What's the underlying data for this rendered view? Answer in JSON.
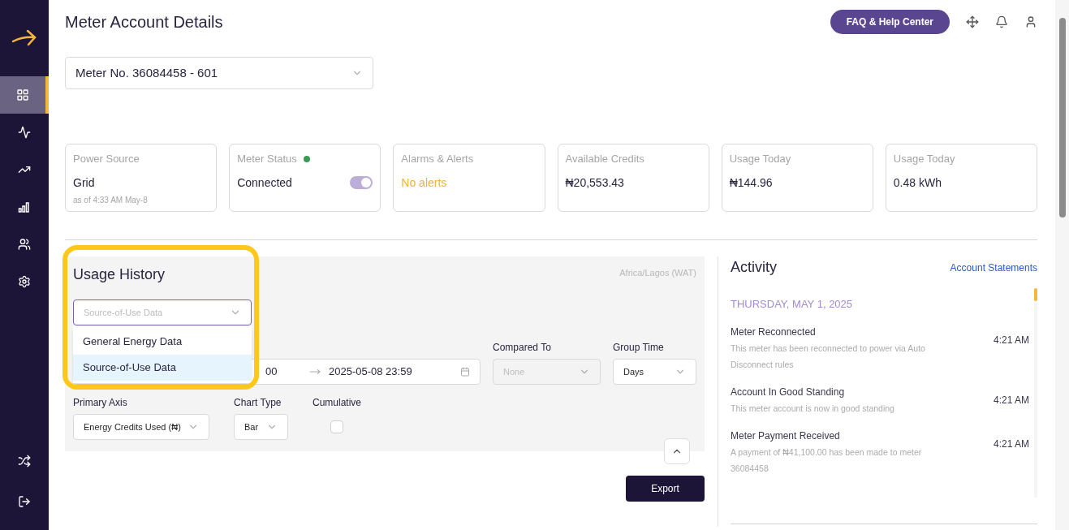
{
  "sidebar": {
    "items": [
      {
        "kind": "grid",
        "selected": true
      },
      {
        "kind": "pulse",
        "selected": false
      },
      {
        "kind": "trend",
        "selected": false
      },
      {
        "kind": "bars",
        "selected": false
      },
      {
        "kind": "users",
        "selected": false
      },
      {
        "kind": "settings",
        "selected": false
      }
    ],
    "bottom_items": [
      {
        "kind": "shuffle"
      },
      {
        "kind": "logout"
      }
    ]
  },
  "header": {
    "title": "Meter Account Details",
    "help_button": "FAQ & Help Center"
  },
  "meter_select": {
    "value": "Meter No. 36084458 - 601"
  },
  "cards": [
    {
      "kind": "plain",
      "label": "Power Source",
      "value": "Grid",
      "note": "as of 4:33 AM May-8"
    },
    {
      "kind": "status",
      "label": "Meter Status",
      "value": "Connected",
      "color": "#3a9b52",
      "toggle_on": true
    },
    {
      "kind": "alert",
      "label": "Alarms & Alerts",
      "value": "No alerts"
    },
    {
      "kind": "plain",
      "label": "Available Credits",
      "value": "₦20,553.43"
    },
    {
      "kind": "plain",
      "label": "Usage Today",
      "value": "₦144.96"
    },
    {
      "kind": "plain",
      "label": "Usage Today",
      "value": "0.48 kWh"
    }
  ],
  "usage_history": {
    "title": "Usage History",
    "timezone": "Africa/Lagos (WAT)",
    "data_select": {
      "placeholder": "Source-of-Use Data",
      "expanded": true,
      "options": [
        {
          "label": "General Energy Data",
          "selected": false
        },
        {
          "label": "Source-of-Use Data",
          "selected": true
        }
      ]
    },
    "date_range": {
      "start": "00",
      "end": "2025-05-08 23:59"
    },
    "compared_to": {
      "label": "Compared To",
      "value": "None",
      "disabled": true
    },
    "group_time": {
      "label": "Group Time",
      "value": "Days"
    },
    "primary_axis": {
      "label": "Primary Axis",
      "value": "Energy Credits Used (₦)"
    },
    "chart_type": {
      "label": "Chart Type",
      "value": "Bar"
    },
    "cumulative": {
      "label": "Cumulative",
      "checked": false
    },
    "export_button": "Export"
  },
  "activity": {
    "title": "Activity",
    "link": "Account Statements",
    "date": "THURSDAY, MAY 1, 2025",
    "items": [
      {
        "title": "Meter Reconnected",
        "description": "This meter has been reconnected to power via Auto Disconnect rules",
        "time": "4:21 AM"
      },
      {
        "title": "Account In Good Standing",
        "description": "This meter account is now in good standing",
        "time": "4:21 AM"
      },
      {
        "title": "Meter Payment Received",
        "description": "A payment of ₦41,100.00 has been made to meter 36084458",
        "time": "4:21 AM"
      }
    ]
  }
}
